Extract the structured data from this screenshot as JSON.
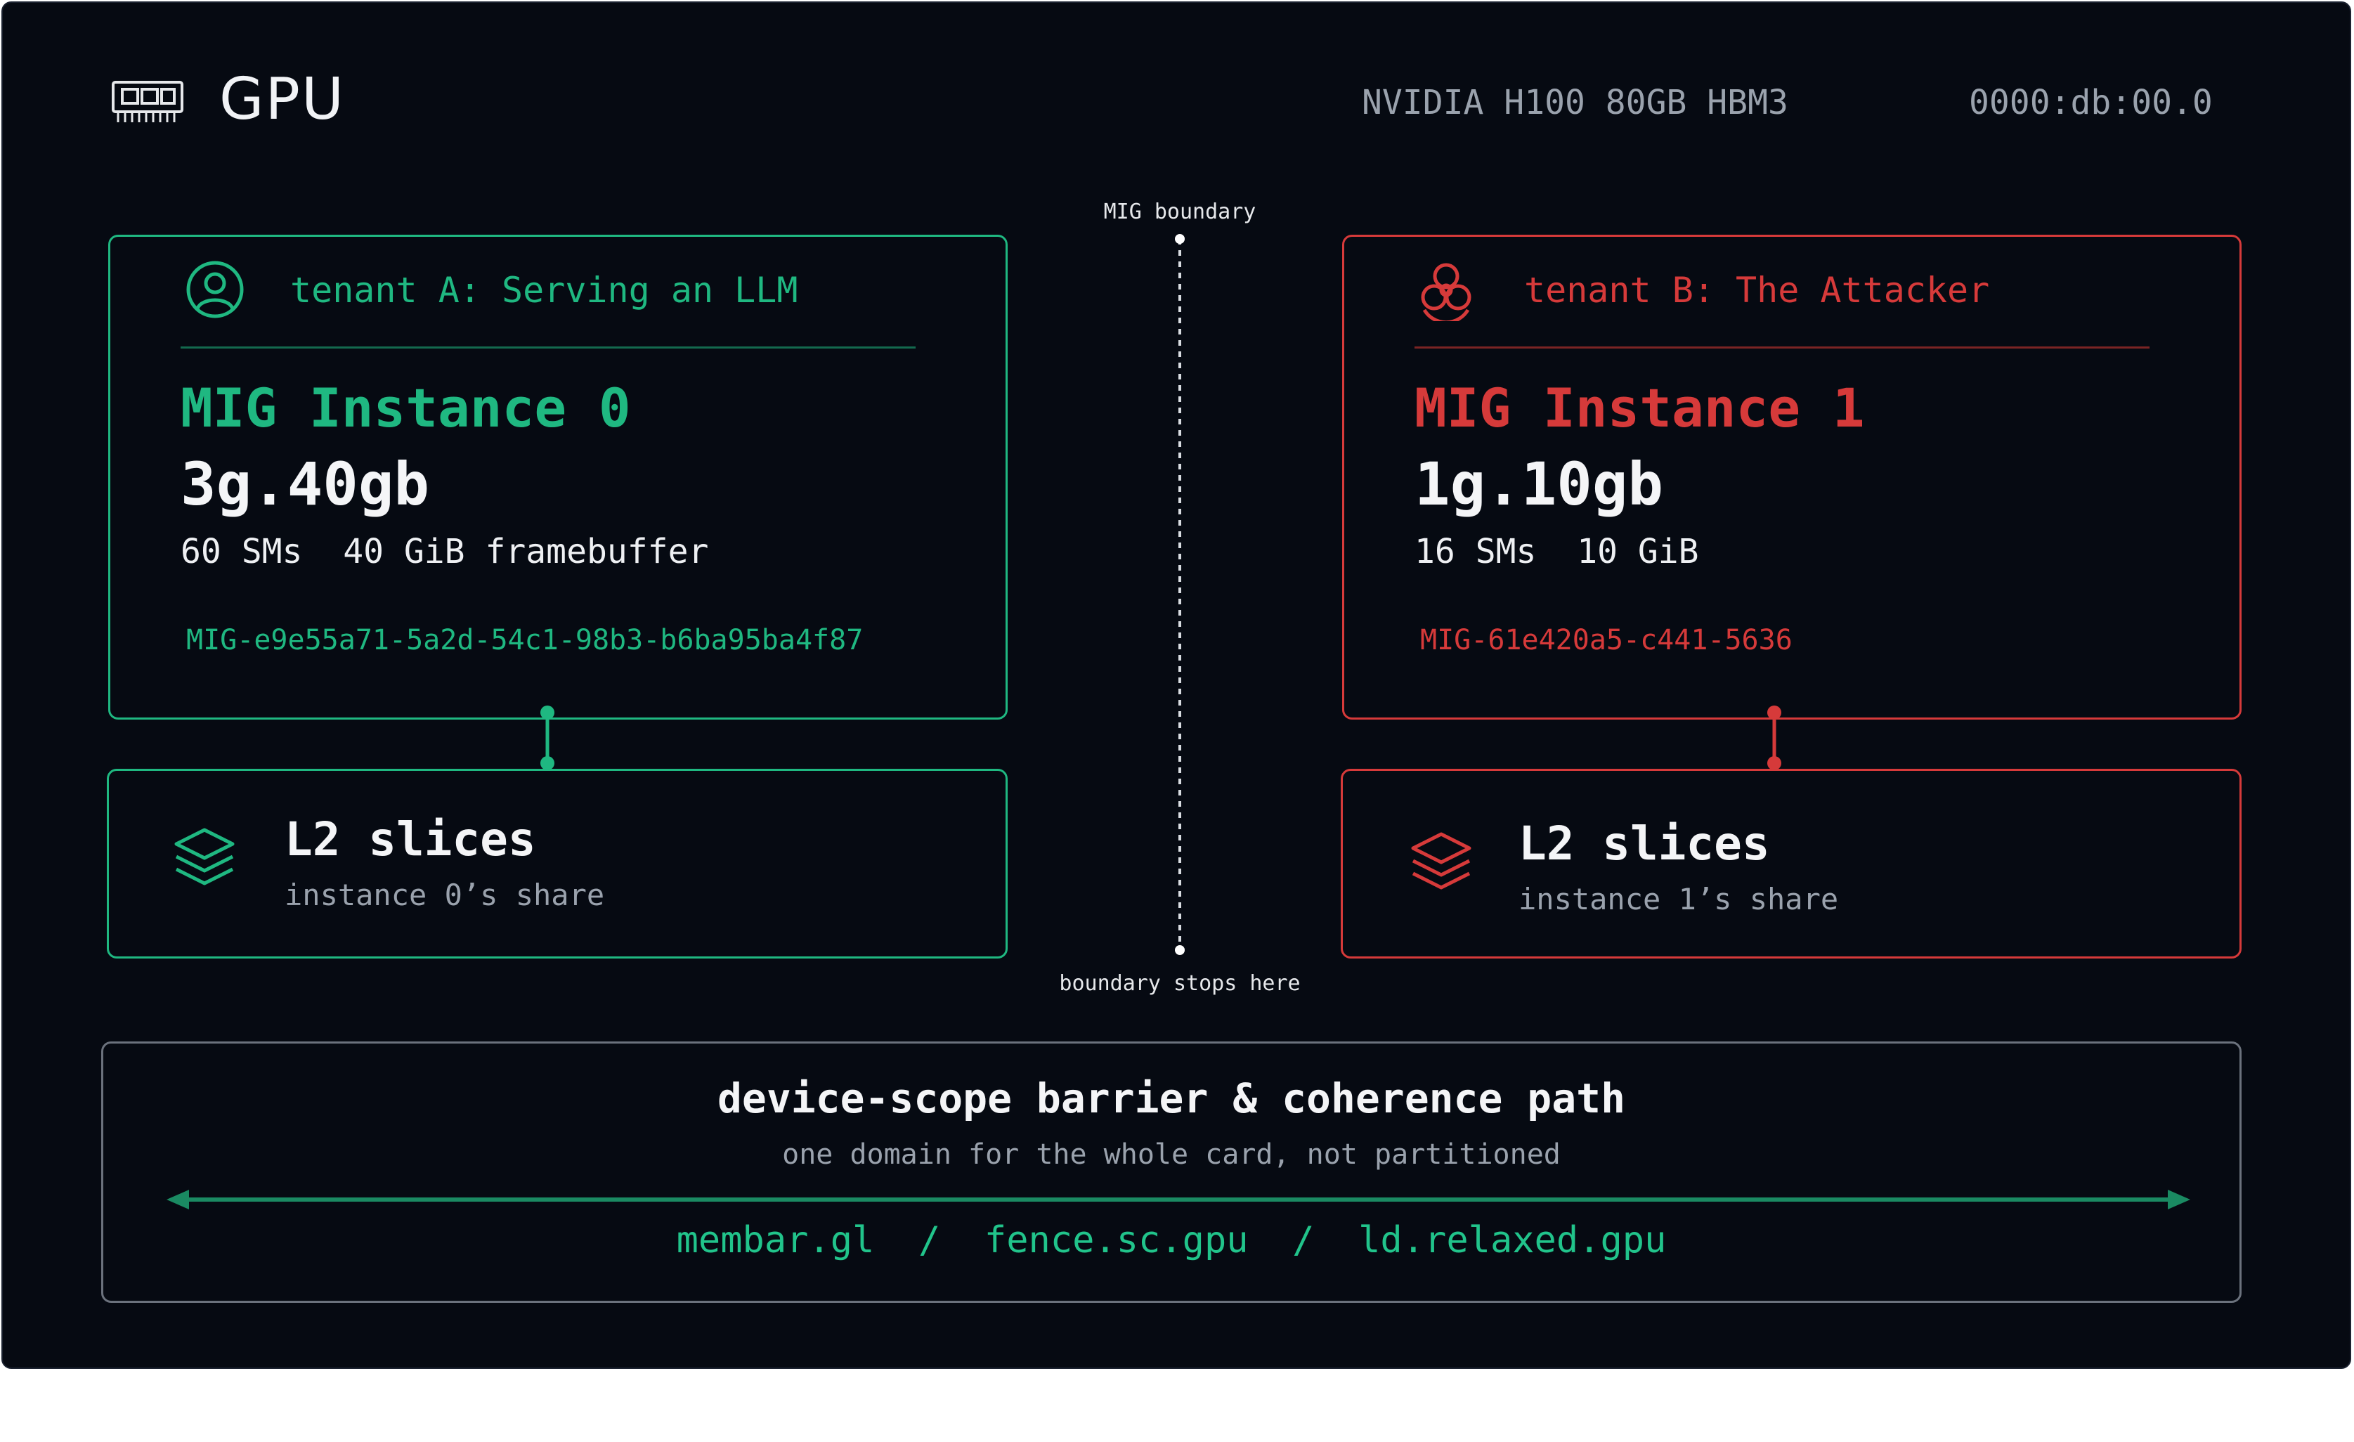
{
  "header": {
    "title": "GPU",
    "model": "NVIDIA H100 80GB HBM3",
    "pci_address": "0000:db:00.0",
    "icon": "gpu-chip-icon"
  },
  "boundary": {
    "top_label": "MIG boundary",
    "bottom_label": "boundary stops here"
  },
  "tenants": [
    {
      "name": "tenant A: Serving an LLM",
      "icon": "user-icon",
      "instance": "MIG Instance 0",
      "profile": "3g.40gb",
      "resources": "60 SMs  40 GiB framebuffer",
      "uuid": "MIG-e9e55a71-5a2d-54c1-98b3-b6ba95ba4f87",
      "color": "#1fb881",
      "l2_title": "L2 slices",
      "l2_sub": "instance 0’s share"
    },
    {
      "name": "tenant B: The Attacker",
      "icon": "biohazard-icon",
      "instance": "MIG Instance 1",
      "profile": "1g.10gb",
      "resources": "16 SMs  10 GiB",
      "uuid": "MIG-61e420a5-c441-5636",
      "color": "#d63a3a",
      "l2_title": "L2 slices",
      "l2_sub": "instance 1’s share"
    }
  ],
  "barrier": {
    "title": "device-scope barrier & coherence path",
    "subtitle": "one domain for the whole card, not partitioned",
    "ops": "membar.gl  /  fence.sc.gpu  /  ld.relaxed.gpu",
    "color": "#21c48b"
  }
}
